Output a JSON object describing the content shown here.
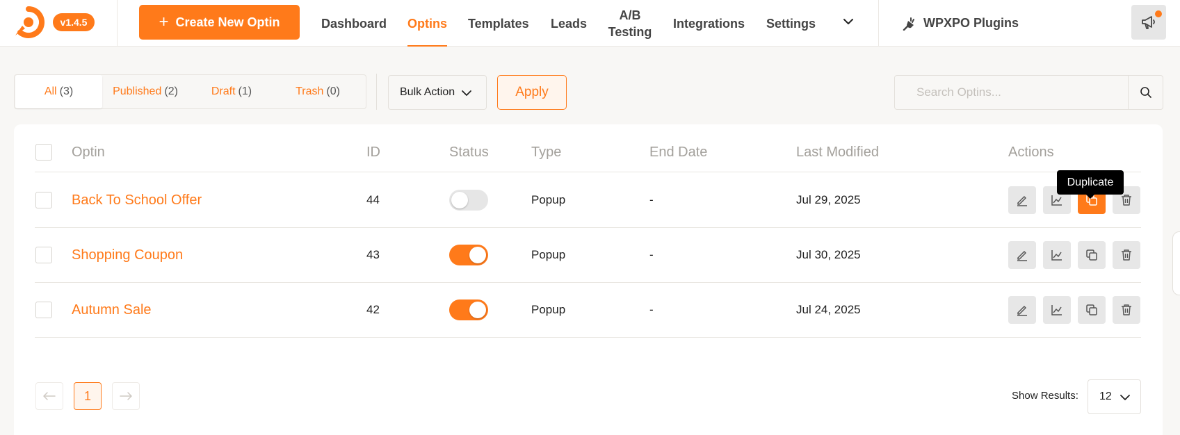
{
  "app": {
    "version": "v1.4.5",
    "create_label": "Create New Optin",
    "brand_color": "#ff7a1a"
  },
  "nav": {
    "items": [
      {
        "label": "Dashboard"
      },
      {
        "label": "Optins"
      },
      {
        "label": "Templates"
      },
      {
        "label": "Leads"
      },
      {
        "label": "A/B Testing"
      },
      {
        "label": "Integrations"
      },
      {
        "label": "Settings"
      }
    ],
    "active": "Optins",
    "more_icon": "chevron-down-icon",
    "plugins_label": "WPXPO Plugins",
    "plugins_icon": "plug-icon",
    "notification_icon": "megaphone-icon"
  },
  "filters": [
    {
      "label": "All",
      "count": "(3)"
    },
    {
      "label": "Published",
      "count": "(2)"
    },
    {
      "label": "Draft",
      "count": "(1)"
    },
    {
      "label": "Trash",
      "count": "(0)"
    }
  ],
  "bulk": {
    "label": "Bulk Action",
    "apply_label": "Apply"
  },
  "search": {
    "placeholder": "Search Optins...",
    "value": ""
  },
  "table": {
    "headers": {
      "optin": "Optin",
      "id": "ID",
      "status": "Status",
      "type": "Type",
      "end_date": "End Date",
      "last_modified": "Last Modified",
      "actions": "Actions"
    },
    "rows": [
      {
        "name": "Back To School Offer",
        "id": "44",
        "status": "off",
        "type": "Popup",
        "end_date": "-",
        "last_modified": "Jul 29, 2025"
      },
      {
        "name": "Shopping Coupon",
        "id": "43",
        "status": "on",
        "type": "Popup",
        "end_date": "-",
        "last_modified": "Jul 30, 2025"
      },
      {
        "name": "Autumn Sale",
        "id": "42",
        "status": "on",
        "type": "Popup",
        "end_date": "-",
        "last_modified": "Jul 24, 2025"
      }
    ],
    "action_icons": [
      "edit-icon",
      "analytics-icon",
      "duplicate-icon",
      "trash-icon"
    ],
    "tooltip": "Duplicate"
  },
  "pagination": {
    "current": "1",
    "show_results_label": "Show Results:",
    "per_page": "12"
  }
}
